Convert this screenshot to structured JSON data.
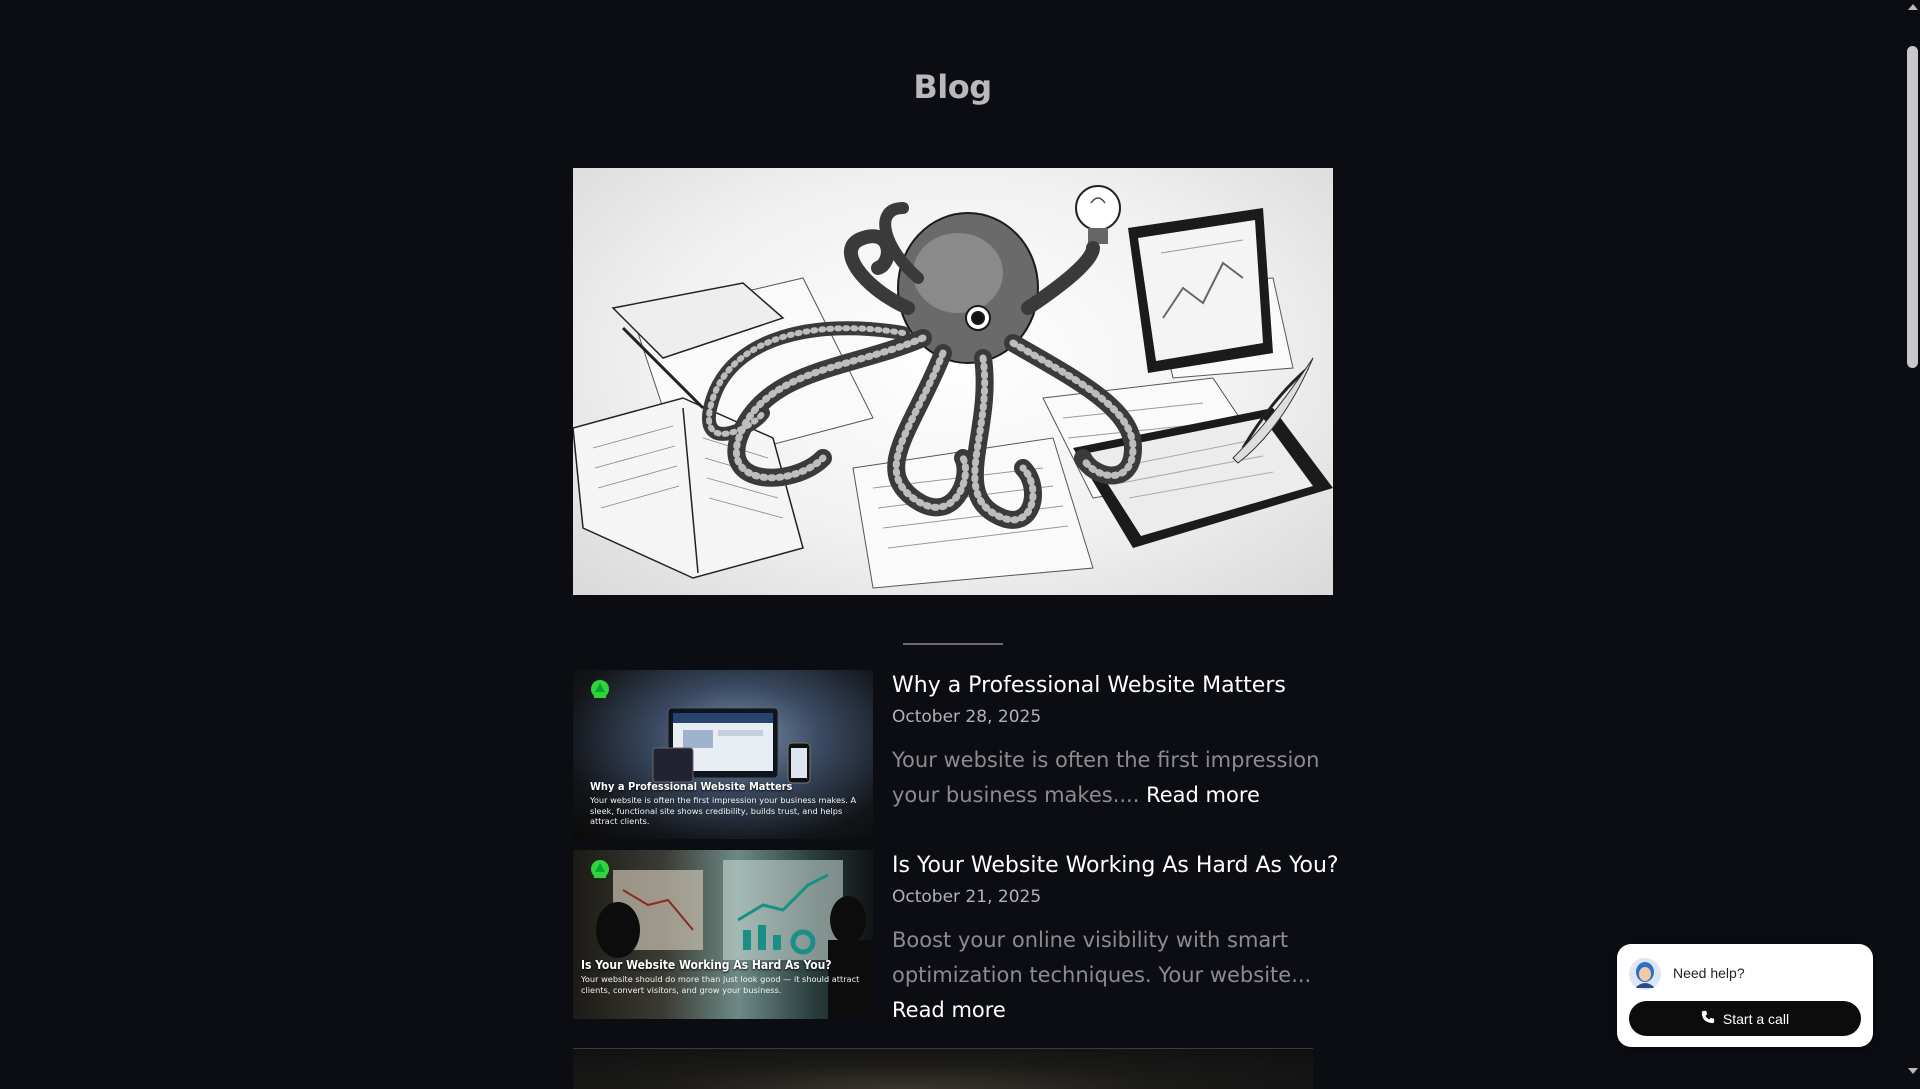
{
  "page": {
    "title": "Blog"
  },
  "posts": [
    {
      "title": "Why a Professional Website Matters",
      "date": "October 28, 2025",
      "excerpt": "Your website is often the first impression your business makes.... ",
      "read_more": "Read more",
      "thumbnail": {
        "heading": "Why a Professional Website Matters",
        "text": "Your website is often the first impression your business makes. A sleek, functional site shows credibility, builds trust, and helps attract clients."
      }
    },
    {
      "title": "Is Your Website Working As Hard As You?",
      "date": "October 21, 2025",
      "excerpt": "Boost your online visibility with smart optimization techniques. Your website... ",
      "read_more": "Read more",
      "thumbnail": {
        "heading": "Is Your Website Working As Hard As You?",
        "text": "Your website should do more than just look good — it should attract clients, convert visitors, and grow your business."
      }
    }
  ],
  "chat_widget": {
    "prompt": "Need help?",
    "button_label": "Start a call"
  },
  "colors": {
    "background": "#0b0d13",
    "title": "#b9b9bd",
    "excerpt": "#8b8b90",
    "date": "#b2b2b6",
    "logo_green": "#2fd43a"
  },
  "icons": [
    "octopus-illustration",
    "phone-icon",
    "avatar-icon",
    "logo-icon"
  ]
}
